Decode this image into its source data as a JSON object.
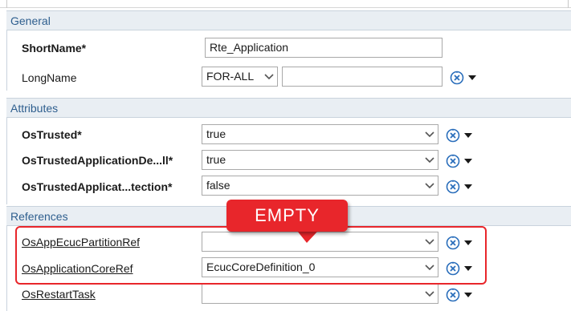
{
  "sections": {
    "general": "General",
    "attributes": "Attributes",
    "references": "References"
  },
  "general": {
    "short_name_label": "ShortName*",
    "short_name_value": "Rte_Application",
    "long_name_label": "LongName",
    "long_name_lang": "FOR-ALL",
    "long_name_value": ""
  },
  "attributes": {
    "os_trusted_label": "OsTrusted*",
    "os_trusted_value": "true",
    "os_trusted_app_label": "OsTrustedApplicationDe...ll*",
    "os_trusted_app_value": "true",
    "os_trusted_prot_label": "OsTrustedApplicat...tection*",
    "os_trusted_prot_value": "false"
  },
  "references": {
    "partition_label": "OsAppEcucPartitionRef",
    "partition_value": "",
    "core_label": "OsApplicationCoreRef",
    "core_value": "EcucCoreDefinition_0",
    "restart_label": "OsRestartTask",
    "restart_value": ""
  },
  "annotation": {
    "callout_text": "EMPTY",
    "color": "#e8262b"
  },
  "colors": {
    "section_header_bg": "#e9eef3",
    "section_header_text": "#2e5e8e",
    "action_icon": "#2a6ebb"
  }
}
